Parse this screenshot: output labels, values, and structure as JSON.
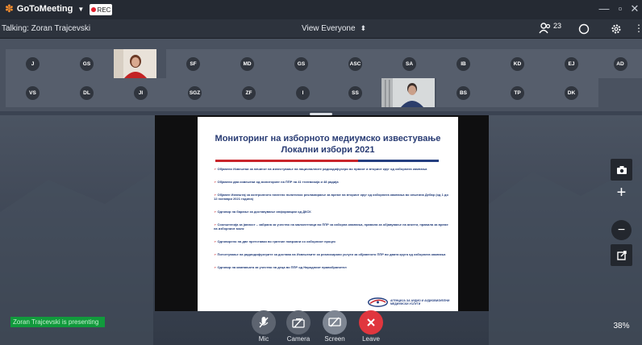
{
  "titlebar": {
    "app_name": "GoToMeeting",
    "rec_label": "REC"
  },
  "infobar": {
    "talking": "Talking: Zoran Trajcevski",
    "view_mode": "View Everyone",
    "attendee_count": "23"
  },
  "gallery": {
    "row1": [
      "J",
      "GS",
      "",
      "SF",
      "MD",
      "GS",
      "ASC",
      "SA",
      "IB",
      "KD",
      "EJ",
      "AD"
    ],
    "row2": [
      "VS",
      "DL",
      "JI",
      "SGZ",
      "ZF",
      "I",
      "SS",
      "",
      "BS",
      "TP",
      "DK"
    ]
  },
  "slide": {
    "title_line1": "Мониторинг на изборното медиумско известување",
    "title_line2": "Локални избори 2021",
    "bullets": [
      "Објавени Извештаи за начинот на известување на националните радиодифузери во првиот и вториот круг од изборната кампања",
      "Објавени два извештаи од мониторинг на ППР на 41 телевизија и 48 радија",
      "Објавен Извештај за контролното платено политичко рекламирање за време на вториот круг од изборната кампања во општина Дебар (од 1 до 12 ноември 2021 година)",
      "Одговор на барање за доставување информации од ДКСК",
      "Соопштенија за јавност – забрана за учество на малолетници во ППР за изборна кампања, правила за објавување на анкети, правила за време на изборниот молк",
      "Одговорено на две претставки во гратние поврзани со изборниот процес",
      "Потсетување на радиодифузерите за достава на Извештаите за реализирани услуги за објавеното ППР во двата круга од изборната кампања",
      "Одговор на кампањата за учество на деца во ППР од Народниот правобранител"
    ],
    "agency_name": "АГЕНЦИЈА ЗА АУДИО И АУДИОВИЗУЕЛНИ МЕДИУМСКИ УСЛУГИ"
  },
  "stage": {
    "zoom_level": "38%",
    "presenting": "Zoran Trajcevski is presenting"
  },
  "controls": {
    "mic": "Mic",
    "camera": "Camera",
    "screen": "Screen",
    "leave": "Leave"
  },
  "colors": {
    "accent_orange": "#f68d2e",
    "rec_red": "#e21d2b",
    "presenting_green": "#119a3c",
    "leave_red": "#e0363e"
  }
}
